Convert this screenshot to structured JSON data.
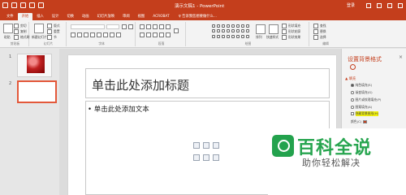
{
  "window": {
    "title": "演示文稿1 - PowerPoint",
    "login": "登录"
  },
  "tabs": [
    "文件",
    "开始",
    "插入",
    "设计",
    "切换",
    "动画",
    "幻灯片放映",
    "审阅",
    "视图",
    "ACROBAT"
  ],
  "search": "♀ 告诉我您想要做什么...",
  "ribbon": {
    "clipboard": {
      "paste": "粘贴",
      "cut": "剪切",
      "copy": "复制",
      "format_painter": "格式刷",
      "label": "剪贴板"
    },
    "slides": {
      "new_slide": "新建幻灯片",
      "layout": "版式",
      "reset": "重置",
      "section": "节",
      "label": "幻灯片"
    },
    "font": {
      "label": "字体"
    },
    "paragraph": {
      "label": "段落"
    },
    "drawing": {
      "arrange": "排列",
      "quick_styles": "快速样式",
      "shape_fill": "形状填充",
      "shape_outline": "形状轮廓",
      "shape_effects": "形状效果",
      "label": "绘图"
    },
    "editing": {
      "find": "查找",
      "replace": "替换",
      "select": "选择",
      "label": "编辑"
    }
  },
  "slides_panel": {
    "numbers": [
      "1",
      "2"
    ]
  },
  "slide": {
    "title_placeholder": "单击此处添加标题",
    "body_placeholder": "• 单击此处添加文本"
  },
  "format_pane": {
    "title": "设置背景格式",
    "close": "×",
    "section": "▲ 填充",
    "options": [
      {
        "label": "纯色填充(S)",
        "selected": true,
        "highlight": false
      },
      {
        "label": "渐变填充(G)",
        "selected": false,
        "highlight": false
      },
      {
        "label": "图片或纹理填充(P)",
        "selected": false,
        "highlight": false
      },
      {
        "label": "图案填充(A)",
        "selected": false,
        "highlight": false
      },
      {
        "label": "隐藏背景图形(H)",
        "selected": false,
        "highlight": true
      }
    ],
    "color_label": "颜色(C)"
  },
  "watermark": {
    "main": "百科全说",
    "sub": "助你轻松解决"
  },
  "colors": {
    "accent": "#c43e1c",
    "highlight": "#f2f20a",
    "brand": "#27a54f"
  }
}
